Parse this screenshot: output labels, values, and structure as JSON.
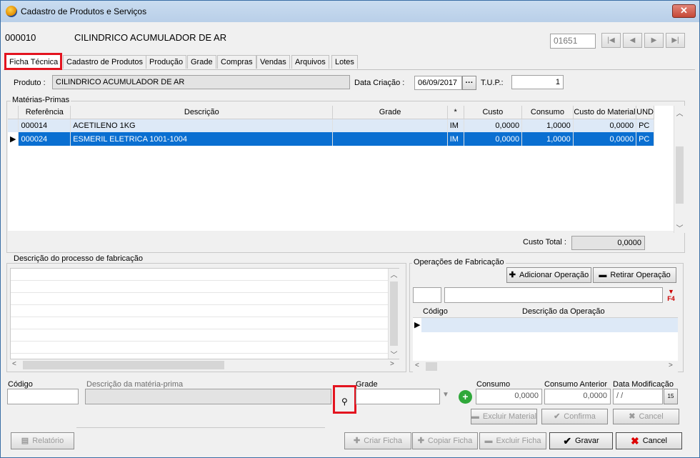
{
  "window": {
    "title": "Cadastro de Produtos e Serviços"
  },
  "header": {
    "code": "000010",
    "name": "CILINDRICO ACUMULADOR DE AR",
    "record_input": "01651"
  },
  "tabs": [
    "Ficha Técnica",
    "Cadastro de Produtos",
    "Produção",
    "Grade",
    "Compras",
    "Vendas",
    "Arquivos",
    "Lotes"
  ],
  "form": {
    "produto_label": "Produto :",
    "produto_value": "CILINDRICO ACUMULADOR DE AR",
    "data_label": "Data Criação :",
    "data_value": "06/09/2017",
    "tup_label": "T.U.P.:",
    "tup_value": "1"
  },
  "materias": {
    "group_label": "Matérias-Primas",
    "columns": [
      "Referência",
      "Descrição",
      "Grade",
      "*",
      "Custo",
      "Consumo",
      "Custo do Material",
      "UND"
    ],
    "rows": [
      {
        "ref": "000014",
        "desc": "ACETILENO 1KG",
        "grade": "",
        "star": "IM",
        "custo": "0,0000",
        "consumo": "1,0000",
        "custo_mat": "0,0000",
        "und": "PC"
      },
      {
        "ref": "000024",
        "desc": "ESMERIL ELETRICA 1001-1004",
        "grade": "",
        "star": "IM",
        "custo": "0,0000",
        "consumo": "1,0000",
        "custo_mat": "0,0000",
        "und": "PC"
      }
    ],
    "custo_total_label": "Custo Total :",
    "custo_total_value": "0,0000"
  },
  "processo": {
    "label": "Descrição do processo de fabricação"
  },
  "operacoes": {
    "label": "Operações de Fabricação",
    "add_label": "Adicionar Operação",
    "remove_label": "Retirar Operação",
    "col_codigo": "Código",
    "col_desc": "Descrição da Operação"
  },
  "bottom": {
    "codigo_label": "Código",
    "desc_label": "Descrição da matéria-prima",
    "grade_label": "Grade",
    "consumo_label": "Consumo",
    "consumo_value": "0,0000",
    "consumo_ant_label": "Consumo Anterior",
    "consumo_ant_value": "0,0000",
    "data_mod_label": "Data Modificação",
    "data_mod_value": " / /"
  },
  "actions": {
    "excluir_material": "Excluir Material",
    "confirma": "Confirma",
    "cancel_small": "Cancel",
    "relatorio": "Relatório",
    "criar_ficha": "Criar Ficha",
    "copiar_ficha": "Copiar Ficha",
    "excluir_ficha": "Excluir Ficha",
    "gravar": "Gravar",
    "cancelar": "Cancel"
  }
}
